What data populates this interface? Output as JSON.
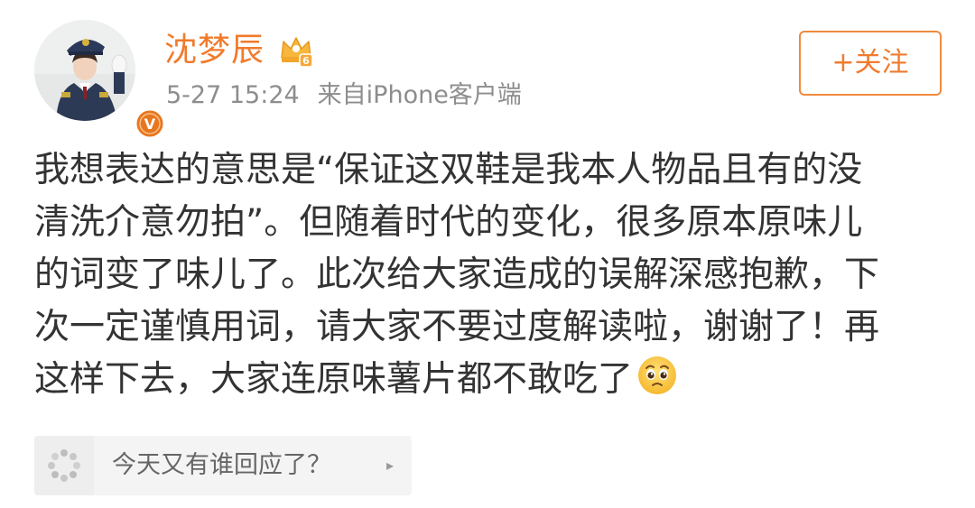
{
  "post": {
    "author": {
      "name": "沈梦辰",
      "verified_badge_letter": "V",
      "vip_level": "6"
    },
    "meta": {
      "time": "5-27 15:24",
      "source": "来自iPhone客户端"
    },
    "follow_label": "+关注",
    "text_lines": [
      "我想表达的意思是“保证这双鞋是我本人物品且有的没",
      "清洗介意勿拍”。但随着时代的变化，很多原本原味儿",
      "的词变了味儿了。此次给大家造成的误解深感抱歉，下",
      "次一定谨慎用词，请大家不要过度解读啦，谢谢了！再",
      "这样下去，大家连原味薯片都不敢吃了"
    ],
    "emoji": "pleading-face-icon"
  },
  "reply_prompt": {
    "text": "今天又有谁回应了？",
    "arrow": "▸"
  },
  "colors": {
    "username": "#f07b2d",
    "follow_border": "#f08a3d",
    "meta_text": "#8d8d8d",
    "body_text": "#333333",
    "reply_bg": "#f4f4f4",
    "verified_badge": "#e8761e"
  }
}
